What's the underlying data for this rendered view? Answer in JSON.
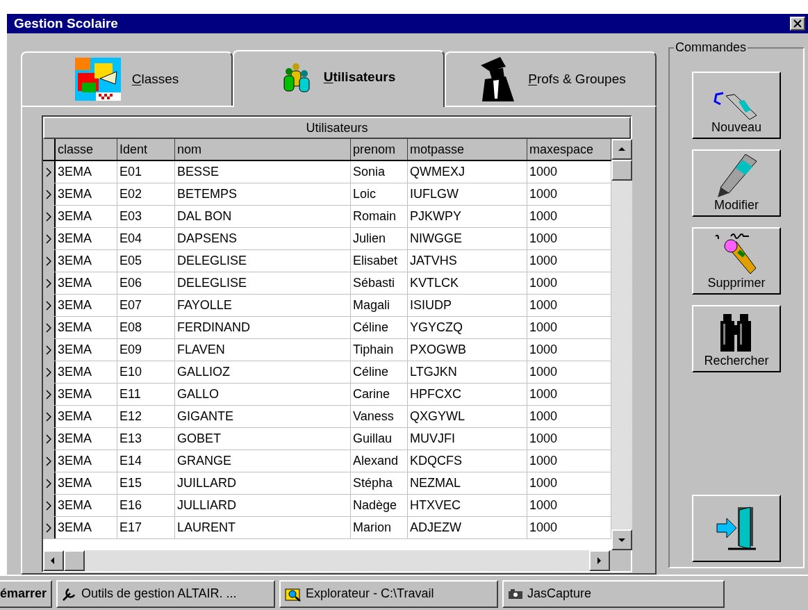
{
  "window": {
    "title": "Gestion Scolaire"
  },
  "tabs": [
    {
      "label": "Classes",
      "selected": false
    },
    {
      "label": "Utilisateurs",
      "selected": true
    },
    {
      "label": "Profs & Groupes",
      "selected": false
    }
  ],
  "grid": {
    "caption": "Utilisateurs",
    "columns": [
      "classe",
      "Ident",
      "nom",
      "prenom",
      "motpasse",
      "maxespace"
    ],
    "rows": [
      [
        "3EMA",
        "E01",
        "BESSE",
        "Sonia",
        "QWMEXJ",
        "1000"
      ],
      [
        "3EMA",
        "E02",
        "BETEMPS",
        "Loic",
        "IUFLGW",
        "1000"
      ],
      [
        "3EMA",
        "E03",
        "DAL BON",
        "Romain",
        "PJKWPY",
        "1000"
      ],
      [
        "3EMA",
        "E04",
        "DAPSENS",
        "Julien",
        "NIWGGE",
        "1000"
      ],
      [
        "3EMA",
        "E05",
        "DELEGLISE",
        "Elisabet",
        "JATVHS",
        "1000"
      ],
      [
        "3EMA",
        "E06",
        "DELEGLISE",
        "Sébasti",
        "KVTLCK",
        "1000"
      ],
      [
        "3EMA",
        "E07",
        "FAYOLLE",
        "Magali",
        "ISIUDP",
        "1000"
      ],
      [
        "3EMA",
        "E08",
        "FERDINAND",
        "Céline",
        "YGYCZQ",
        "1000"
      ],
      [
        "3EMA",
        "E09",
        "FLAVEN",
        "Tiphain",
        "PXOGWB",
        "1000"
      ],
      [
        "3EMA",
        "E10",
        "GALLIOZ",
        "Céline",
        "LTGJKN",
        "1000"
      ],
      [
        "3EMA",
        "E11",
        "GALLO",
        "Carine",
        "HPFCXC",
        "1000"
      ],
      [
        "3EMA",
        "E12",
        "GIGANTE",
        "Vaness",
        "QXGYWL",
        "1000"
      ],
      [
        "3EMA",
        "E13",
        "GOBET",
        "Guillau",
        "MUVJFI",
        "1000"
      ],
      [
        "3EMA",
        "E14",
        "GRANGE",
        "Alexand",
        "KDQCFS",
        "1000"
      ],
      [
        "3EMA",
        "E15",
        "JUILLARD",
        "Stépha",
        "NEZMAL",
        "1000"
      ],
      [
        "3EMA",
        "E16",
        "JULLIARD",
        "Nadège",
        "HTXVEC",
        "1000"
      ],
      [
        "3EMA",
        "E17",
        "LAURENT",
        "Marion",
        "ADJEZW",
        "1000"
      ]
    ]
  },
  "commands": {
    "title": "Commandes",
    "buttons": [
      {
        "label": "Nouveau",
        "kind": "new"
      },
      {
        "label": "Modifier",
        "kind": "edit"
      },
      {
        "label": "Supprimer",
        "kind": "delete"
      },
      {
        "label": "Rechercher",
        "kind": "search"
      }
    ]
  },
  "taskbar": {
    "start": "émarrer",
    "items": [
      "Outils de gestion ALTAIR. ...",
      "Explorateur - C:\\Travail",
      "JasCapture"
    ]
  }
}
